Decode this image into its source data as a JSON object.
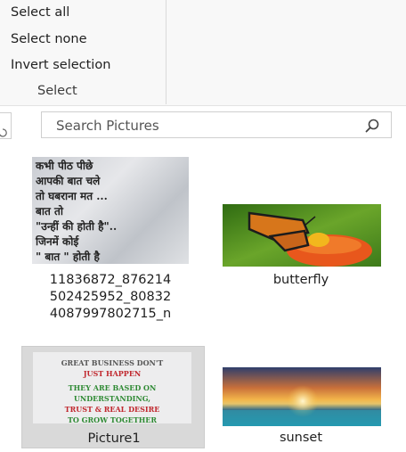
{
  "ribbon": {
    "select_all": "Select all",
    "select_none": "Select none",
    "invert_selection": "Invert selection",
    "group_label": "Select"
  },
  "search": {
    "placeholder": "Search Pictures",
    "icon": "search-icon"
  },
  "files": [
    {
      "name_lines": [
        "11836872_876214",
        "502425952_80832",
        "4087997802715_n"
      ],
      "thumb_text": [
        "कभी पीठ पीछे",
        "आपकी बात चले",
        "तो घबराना मत ...",
        "बात तो",
        "\"उन्हीं की होती है\"..",
        "जिनमें कोई",
        "\" बात \" होती है"
      ]
    },
    {
      "name": "butterfly"
    },
    {
      "name": "Picture1",
      "selected": true,
      "thumb_text": [
        "GREAT BUSINESS DON'T",
        "JUST HAPPEN",
        "THEY ARE BASED ON",
        "UNDERSTANDING,",
        "TRUST & REAL DESIRE",
        "TO GROW TOGETHER"
      ]
    },
    {
      "name": "sunset"
    }
  ]
}
